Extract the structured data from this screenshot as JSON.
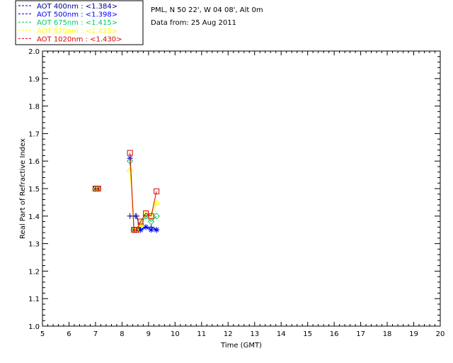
{
  "chart_data": {
    "type": "line",
    "xlabel": "Time (GMT)",
    "ylabel": "Real Part of Refractive Index",
    "xlim": [
      5,
      20
    ],
    "ylim": [
      1.0,
      2.0
    ],
    "xticks": [
      "5",
      "6",
      "7",
      "8",
      "9",
      "10",
      "11",
      "12",
      "13",
      "14",
      "15",
      "16",
      "17",
      "18",
      "19",
      "20"
    ],
    "yticks": [
      "1.0",
      "1.1",
      "1.2",
      "1.3",
      "1.4",
      "1.5",
      "1.6",
      "1.7",
      "1.8",
      "1.9",
      "2.0"
    ],
    "info_lines": [
      "PML, N 50 22', W 04 08', Alt 0m",
      "Data from: 25 Aug 2011"
    ],
    "legend_placement": "top-left",
    "series": [
      {
        "name": "AOT  400nm : <1.384>",
        "color": "#00008b",
        "marker": "plus",
        "x": [
          7.0,
          7.1,
          8.3,
          8.5,
          8.55,
          8.7,
          8.9,
          9.1,
          9.3
        ],
        "y": [
          1.5,
          1.5,
          1.4,
          1.4,
          1.4,
          1.35,
          1.36,
          1.36,
          1.35
        ]
      },
      {
        "name": "AOT  500nm : <1.398>",
        "color": "#0000ff",
        "marker": "asterisk",
        "x": [
          7.0,
          7.1,
          8.3,
          8.45,
          8.55,
          8.7,
          8.9,
          9.1,
          9.3
        ],
        "y": [
          1.5,
          1.5,
          1.61,
          1.35,
          1.35,
          1.35,
          1.36,
          1.35,
          1.35
        ]
      },
      {
        "name": "AOT  675nm : <1.415>",
        "color": "#00cc66",
        "marker": "diamond",
        "x": [
          7.0,
          7.1,
          8.3,
          8.45,
          8.55,
          8.7,
          8.9,
          9.1,
          9.3
        ],
        "y": [
          1.5,
          1.5,
          1.6,
          1.35,
          1.35,
          1.37,
          1.4,
          1.38,
          1.4
        ]
      },
      {
        "name": "AOT  870nm : <1.425>",
        "color": "#ffff00",
        "marker": "triangle",
        "x": [
          7.0,
          7.1,
          8.3,
          8.45,
          8.55,
          8.7,
          8.9,
          9.1,
          9.3
        ],
        "y": [
          1.5,
          1.5,
          1.57,
          1.35,
          1.35,
          1.37,
          1.41,
          1.4,
          1.45
        ]
      },
      {
        "name": "AOT 1020nm : <1.430>",
        "color": "#dd0000",
        "marker": "square",
        "x": [
          7.0,
          7.1,
          8.3,
          8.45,
          8.55,
          8.7,
          8.9,
          9.1,
          9.3
        ],
        "y": [
          1.5,
          1.5,
          1.63,
          1.35,
          1.35,
          1.38,
          1.41,
          1.4,
          1.49
        ]
      }
    ]
  }
}
